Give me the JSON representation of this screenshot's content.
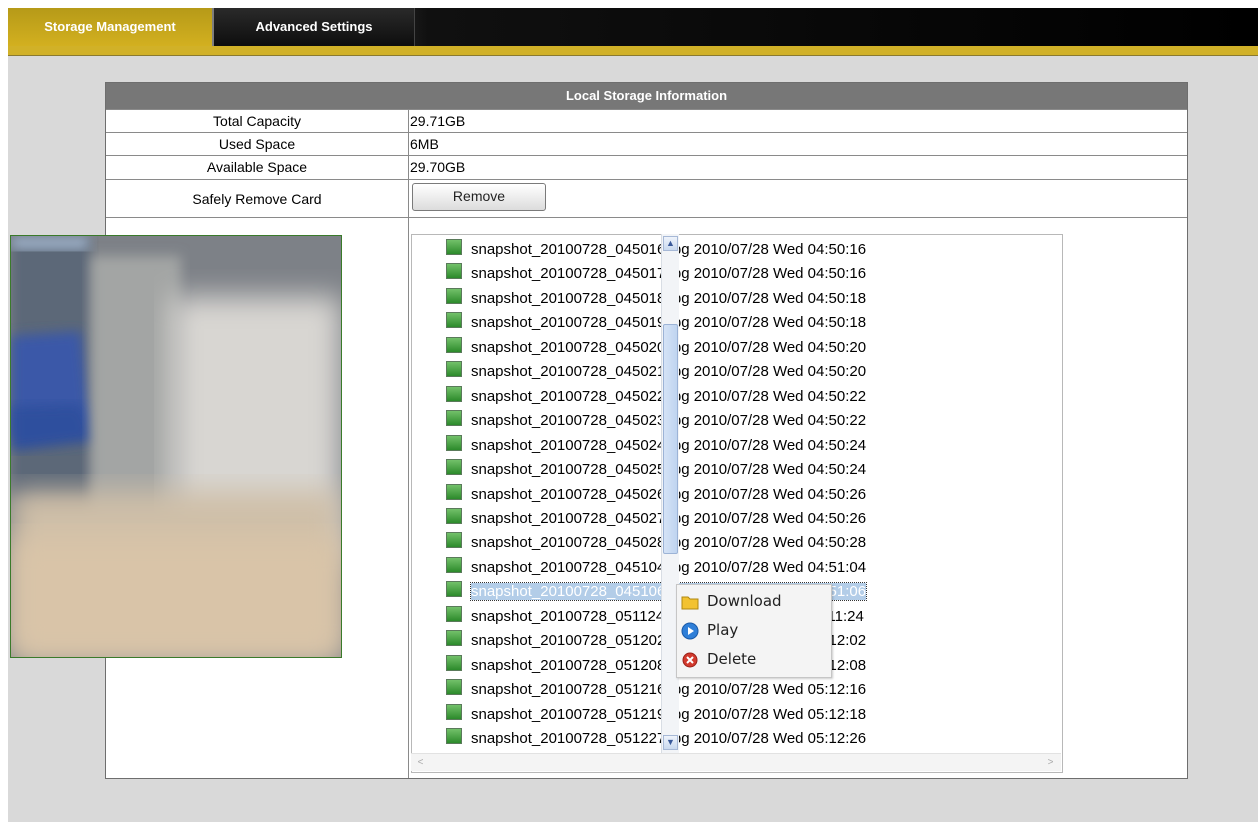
{
  "tabs": [
    {
      "label": "Storage Management",
      "active": true
    },
    {
      "label": "Advanced Settings",
      "active": false
    }
  ],
  "info": {
    "header": "Local Storage Information",
    "rows": [
      {
        "label": "Total Capacity",
        "value": "29.71GB"
      },
      {
        "label": "Used Space",
        "value": "6MB"
      },
      {
        "label": "Available Space",
        "value": "29.70GB"
      }
    ],
    "remove_label": "Safely Remove Card",
    "remove_button": "Remove"
  },
  "files": [
    "snapshot_20100728_045016.jpg 2010/07/28 Wed 04:50:16",
    "snapshot_20100728_045017.jpg 2010/07/28 Wed 04:50:16",
    "snapshot_20100728_045018.jpg 2010/07/28 Wed 04:50:18",
    "snapshot_20100728_045019.jpg 2010/07/28 Wed 04:50:18",
    "snapshot_20100728_045020.jpg 2010/07/28 Wed 04:50:20",
    "snapshot_20100728_045021.jpg 2010/07/28 Wed 04:50:20",
    "snapshot_20100728_045022.jpg 2010/07/28 Wed 04:50:22",
    "snapshot_20100728_045023.jpg 2010/07/28 Wed 04:50:22",
    "snapshot_20100728_045024.jpg 2010/07/28 Wed 04:50:24",
    "snapshot_20100728_045025.jpg 2010/07/28 Wed 04:50:24",
    "snapshot_20100728_045026.jpg 2010/07/28 Wed 04:50:26",
    "snapshot_20100728_045027.jpg 2010/07/28 Wed 04:50:26",
    "snapshot_20100728_045028.jpg 2010/07/28 Wed 04:50:28",
    "snapshot_20100728_045104.jpg 2010/07/28 Wed 04:51:04",
    "snapshot_20100728_045106.jpg 2010/07/28 Wed 04:51:06",
    "snapshot_20100728_051124.jpg 2010/07/28 Wed 05:11:24",
    "snapshot_20100728_051202.jpg 2010/07/28 Wed 05:12:02",
    "snapshot_20100728_051208.jpg 2010/07/28 Wed 05:12:08",
    "snapshot_20100728_051216.jpg 2010/07/28 Wed 05:12:16",
    "snapshot_20100728_051219.jpg 2010/07/28 Wed 05:12:18",
    "snapshot_20100728_051227.jpg 2010/07/28 Wed 05:12:26"
  ],
  "selected_index": 14,
  "context_menu": [
    {
      "label": "Download",
      "icon": "folder-icon",
      "color": "#f2c230"
    },
    {
      "label": "Play",
      "icon": "play-icon",
      "color": "#2f7fd8"
    },
    {
      "label": "Delete",
      "icon": "delete-icon",
      "color": "#d23a2e"
    }
  ],
  "colors": {
    "active_tab": "#d1b128",
    "header_bg": "#777777",
    "selection": "#b3cde8"
  }
}
